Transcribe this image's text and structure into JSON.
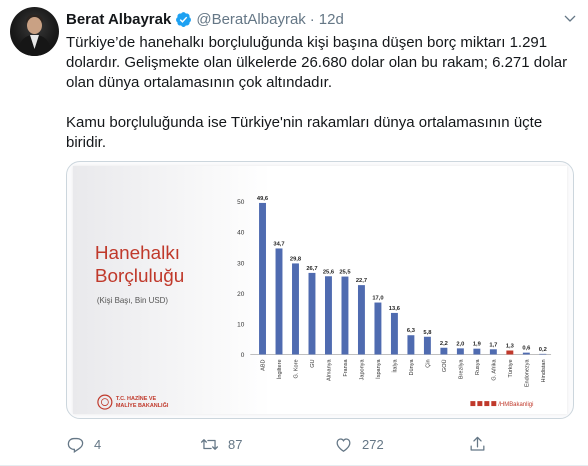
{
  "tweet": {
    "author_name": "Berat Albayrak",
    "handle": "@BeratAlbayrak",
    "dot": "·",
    "time": "12d",
    "paragraphs": [
      "Türkiye’de hanehalkı borçluluğunda kişi başına düşen borç miktarı 1.291 dolardır. Gelişmekte olan ülkelerde 26.680 dolar olan bu rakam; 6.271 dolar olan dünya ortalamasının çok altındadır.",
      "Kamu borçluluğunda ise Türkiye'nin rakamları dünya ortalamasının üçte biridir."
    ],
    "actions": {
      "reply_count": "4",
      "retweet_count": "87",
      "like_count": "272"
    },
    "icons": {
      "verified": "verified-badge-icon",
      "more": "chevron-down-icon",
      "reply": "reply-icon",
      "retweet": "retweet-icon",
      "like": "heart-icon",
      "share": "share-icon"
    },
    "colors": {
      "accent": "#1da1f2",
      "text": "#14171a",
      "muted": "#657786",
      "bar": "#4f6bb0",
      "bar_highlight": "#c0392b",
      "chart_title": "#c0392b"
    }
  },
  "chart_data": {
    "type": "bar",
    "title": "Hanehalkı Borçluluğu",
    "subtitle": "(Kişi Başı, Bin USD)",
    "categories": [
      "ABD",
      "İngiltere",
      "G. Kore",
      "GU",
      "Almanya",
      "Fransa",
      "Japonya",
      "İspanya",
      "İtalya",
      "Dünya",
      "Çin",
      "GOÜ",
      "Brezilya",
      "Rusya",
      "G. Afrika",
      "Türkiye",
      "Endonezya",
      "Hindistan"
    ],
    "values": [
      49.6,
      34.7,
      29.8,
      26.7,
      25.6,
      25.5,
      22.7,
      17.0,
      13.6,
      6.3,
      5.8,
      2.2,
      2.0,
      1.9,
      1.7,
      1.3,
      0.6,
      0.2
    ],
    "value_labels": [
      "49,6",
      "34,7",
      "29,8",
      "26,7",
      "25,6",
      "25,5",
      "22,7",
      "17,0",
      "13,6",
      "6,3",
      "5,8",
      "2,2",
      "2,0",
      "1,9",
      "1,7",
      "1,3",
      "0,6",
      "0,2"
    ],
    "highlight": "Türkiye",
    "yticks": [
      0,
      10,
      20,
      30,
      40,
      50
    ],
    "ylim": [
      0,
      50
    ],
    "grid": false,
    "xlabel": "",
    "ylabel": "",
    "logo_text": [
      "T.C. HAZİNE VE",
      "MALİYE BAKANLIĞI"
    ],
    "social_text": "/HMBakanligi"
  }
}
